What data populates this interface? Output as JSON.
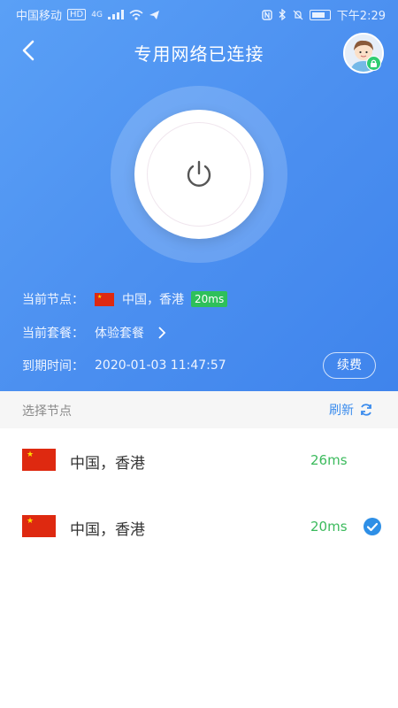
{
  "status_bar": {
    "carrier": "中国移动",
    "hd_badge": "HD",
    "network_type": "4G",
    "time": "下午2:29",
    "icons": [
      "signal-icon",
      "wifi-icon",
      "send-icon",
      "nfc-icon",
      "bluetooth-icon",
      "mute-icon",
      "battery-icon"
    ]
  },
  "header": {
    "title": "专用网络已连接",
    "back_icon": "chevron-left-icon",
    "avatar_icon": "avatar-icon",
    "badge_icon": "lock-icon"
  },
  "connection": {
    "power_icon": "power-icon",
    "current_node_label": "当前节点：",
    "current_node": "中国，香港",
    "current_latency": "20ms",
    "plan_label": "当前套餐：",
    "plan_value": "体验套餐",
    "expiry_label": "到期时间：",
    "expiry_value": "2020-01-03 11:47:57",
    "renew_label": "续费"
  },
  "node_list": {
    "section_title": "选择节点",
    "refresh_label": "刷新",
    "nodes": [
      {
        "name": "中国，香港",
        "latency": "26ms",
        "selected": false,
        "flag": "china-flag-icon"
      },
      {
        "name": "中国，香港",
        "latency": "20ms",
        "selected": true,
        "flag": "china-flag-icon"
      }
    ]
  },
  "colors": {
    "header_gradient_start": "#5aa0f6",
    "header_gradient_end": "#3f84ec",
    "accent_blue": "#3b8ced",
    "latency_green": "#3bba5c",
    "badge_green": "#2ec05a",
    "flag_red": "#de2910"
  }
}
